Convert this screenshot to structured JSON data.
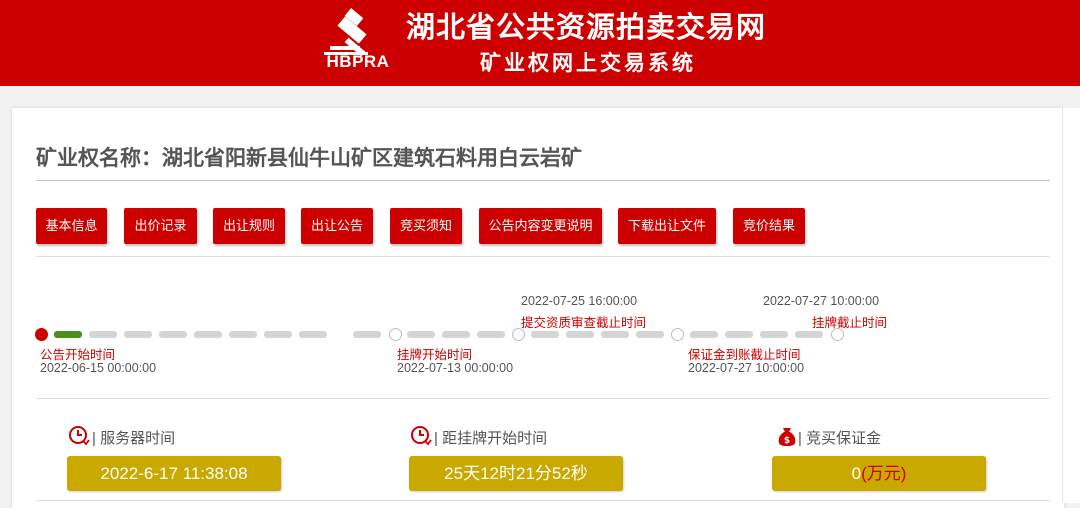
{
  "site": {
    "logo_text": "HBPRA",
    "title": "湖北省公共资源拍卖交易网",
    "subtitle": "矿业权网上交易系统"
  },
  "mineral": {
    "title": "矿业权名称：湖北省阳新县仙牛山矿区建筑石料用白云岩矿"
  },
  "tabs": [
    {
      "label": "基本信息"
    },
    {
      "label": "出价记录"
    },
    {
      "label": "出让规则"
    },
    {
      "label": "出让公告"
    },
    {
      "label": "竞买须知"
    },
    {
      "label": "公告内容变更说明"
    },
    {
      "label": "下载出让文件"
    },
    {
      "label": "竞价结果"
    }
  ],
  "timeline": {
    "milestones": [
      {
        "label": "公告开始时间",
        "time": "2022-06-15 00:00:00"
      },
      {
        "label": "挂牌开始时间",
        "time": "2022-07-13 00:00:00"
      },
      {
        "label": "提交资质审查截止时间",
        "time": "2022-07-25 16:00:00"
      },
      {
        "label": "保证金到账截止时间",
        "time": "2022-07-27 10:00:00"
      },
      {
        "label": "挂牌截止时间",
        "time": "2022-07-27 10:00:00"
      }
    ]
  },
  "info": {
    "server_time": {
      "label": "| 服务器时间",
      "value": "2022-6-17 11:38:08",
      "icon": "clock-icon"
    },
    "countdown": {
      "label": "| 距挂牌开始时间",
      "value": "25天12时21分52秒",
      "icon": "clock-icon"
    },
    "deposit": {
      "label": "| 竞买保证金",
      "value": "0",
      "unit": "(万元)",
      "icon": "money-bag-icon"
    }
  },
  "colors": {
    "brand_red": "#cc0000",
    "gold": "#c9a900",
    "progress_green": "#4d8f1f"
  }
}
